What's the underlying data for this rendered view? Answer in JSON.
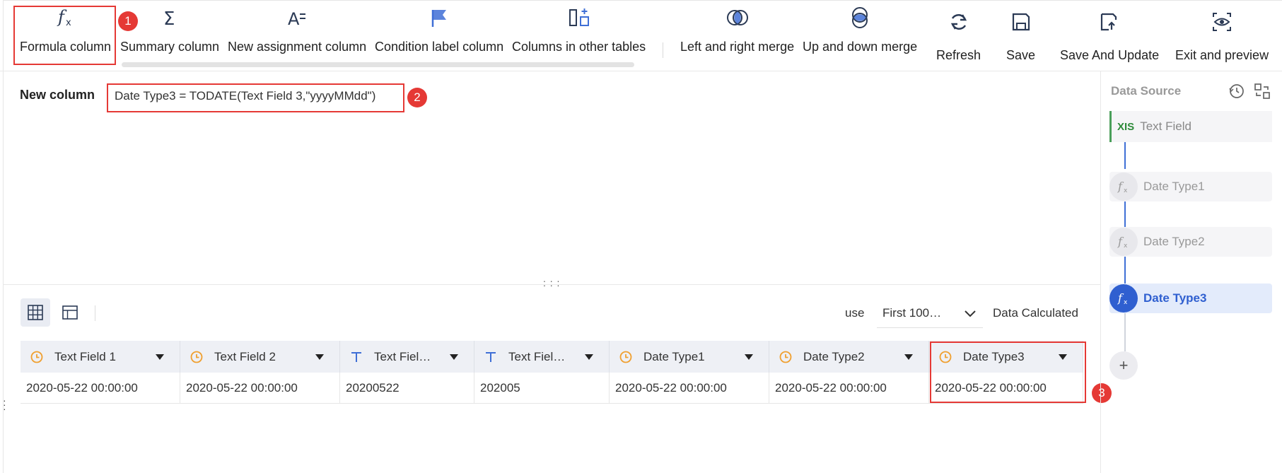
{
  "toolbar": {
    "items": [
      {
        "label": "Formula column",
        "icon": "formula-icon"
      },
      {
        "label": "Summary column",
        "icon": "sigma-icon"
      },
      {
        "label": "New assignment column",
        "icon": "assignment-icon"
      },
      {
        "label": "Condition label column",
        "icon": "flag-icon"
      },
      {
        "label": "Columns in other tables",
        "icon": "columns-add-icon"
      },
      {
        "label": "Left and right merge",
        "icon": "merge-lr-icon"
      },
      {
        "label": "Up and down merge",
        "icon": "merge-ud-icon"
      },
      {
        "label": "Refresh",
        "icon": "refresh-icon"
      },
      {
        "label": "Save",
        "icon": "save-icon"
      },
      {
        "label": "Save And Update",
        "icon": "save-update-icon"
      },
      {
        "label": "Exit and preview",
        "icon": "preview-icon"
      }
    ]
  },
  "annotations": {
    "badge1": "1",
    "badge2": "2",
    "badge3": "3",
    "accent": "#e53935"
  },
  "formula": {
    "label": "New column",
    "expression": "Date Type3 = TODATE(Text Field 3,\"yyyyMMdd\")"
  },
  "controls": {
    "use_label": "use",
    "rows_select": "First 100…",
    "status": "Data Calculated"
  },
  "table": {
    "columns": [
      {
        "name": "Text Field 1",
        "type": "date-icon"
      },
      {
        "name": "Text Field 2",
        "type": "date-icon"
      },
      {
        "name": "Text Fiel…",
        "type": "text-icon"
      },
      {
        "name": "Text Fiel…",
        "type": "text-icon"
      },
      {
        "name": "Date Type1",
        "type": "date-icon"
      },
      {
        "name": "Date Type2",
        "type": "date-icon"
      },
      {
        "name": "Date Type3",
        "type": "date-icon"
      }
    ],
    "row": [
      "2020-05-22 00:00:00",
      "2020-05-22 00:00:00",
      "20200522",
      "202005",
      "2020-05-22 00:00:00",
      "2020-05-22 00:00:00",
      "2020-05-22 00:00:00"
    ]
  },
  "datasource": {
    "title": "Data Source",
    "source": {
      "badge": "XIS",
      "name": "Text Field"
    },
    "steps": [
      {
        "name": "Date Type1",
        "active": false
      },
      {
        "name": "Date Type2",
        "active": false
      },
      {
        "name": "Date Type3",
        "active": true
      }
    ],
    "add": "+",
    "accent": "#2f5fd0"
  }
}
